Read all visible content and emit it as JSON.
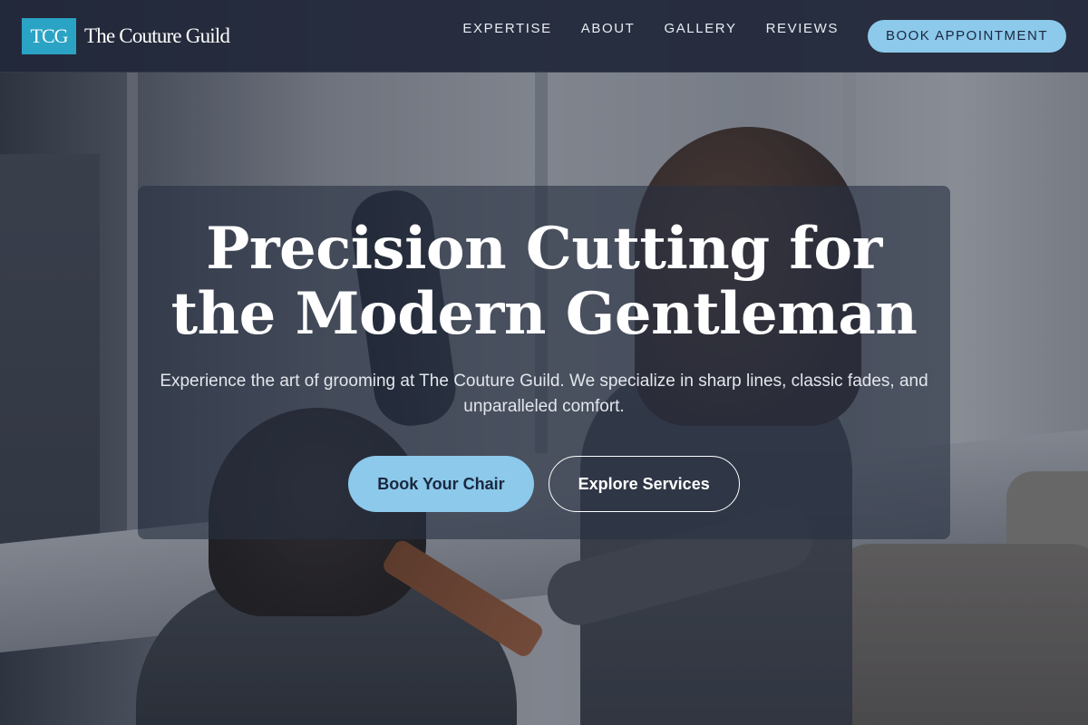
{
  "brand": {
    "mark": "TCG",
    "name": "The Couture Guild",
    "accent_color": "#2aa3c4"
  },
  "nav": {
    "items": [
      {
        "label": "EXPERTISE"
      },
      {
        "label": "ABOUT"
      },
      {
        "label": "GALLERY"
      },
      {
        "label": "REVIEWS"
      }
    ],
    "cta_label": "BOOK APPOINTMENT",
    "cta_color": "#8cc9ea"
  },
  "hero": {
    "title": "Precision Cutting for the Modern Gentleman",
    "subtitle": "Experience the art of grooming at The Couture Guild. We specialize in sharp lines, classic fades, and unparalleled comfort.",
    "primary_button": "Book Your Chair",
    "secondary_button": "Explore Services"
  }
}
